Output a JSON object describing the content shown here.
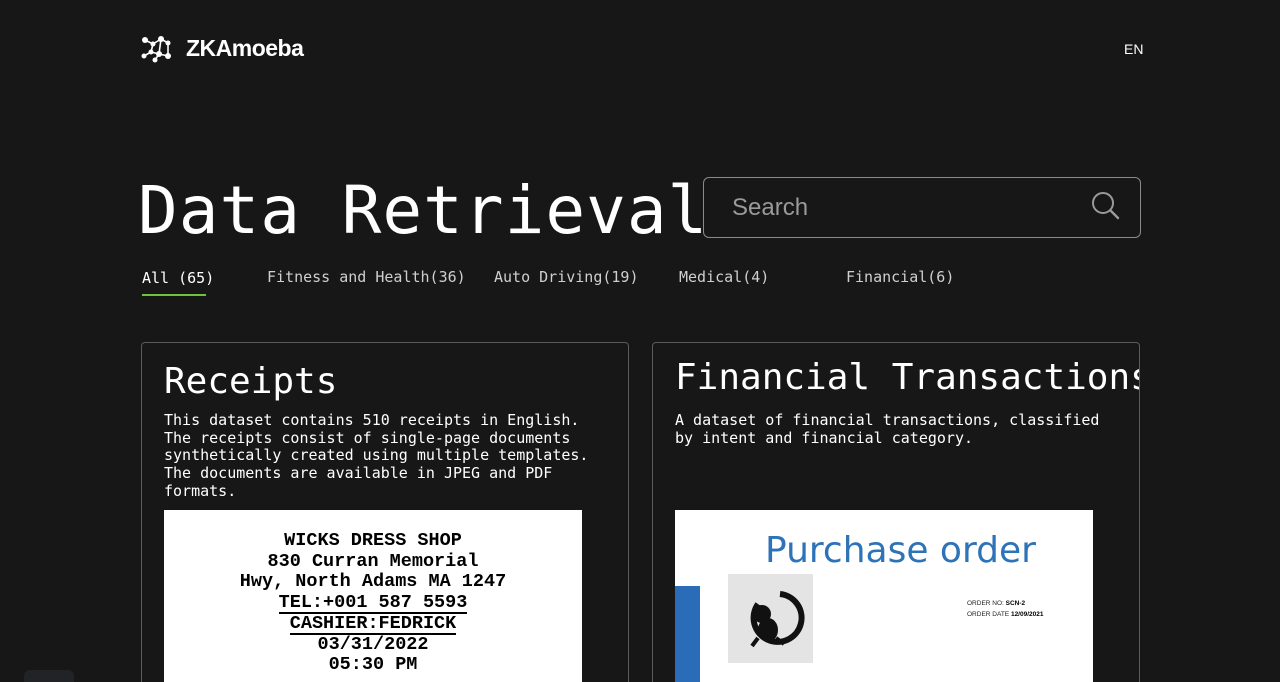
{
  "header": {
    "brand": "ZKAmoeba",
    "language": "EN"
  },
  "page": {
    "title": "Data Retrieval"
  },
  "search": {
    "placeholder": "Search",
    "value": ""
  },
  "tabs": [
    {
      "label": "All (65)",
      "active": true
    },
    {
      "label": "Fitness and Health(36)",
      "active": false
    },
    {
      "label": "Auto Driving(19)",
      "active": false
    },
    {
      "label": "Medical(4)",
      "active": false
    },
    {
      "label": "Financial(6)",
      "active": false
    }
  ],
  "accent_color": "#6fc23b",
  "cards": [
    {
      "title": "Receipts",
      "description": "This dataset contains 510 receipts in English. The receipts consist of single-page documents synthetically created using multiple templates. The documents are available in JPEG and PDF formats.",
      "preview": {
        "shop": "WICKS DRESS SHOP",
        "address1": "830 Curran Memorial",
        "address2": "Hwy, North Adams MA 1247",
        "tel": "TEL:+001 587 5593",
        "cashier": "CASHIER:FEDRICK",
        "date": "03/31/2022",
        "time": "05:30 PM"
      }
    },
    {
      "title": "Financial Transactions",
      "description": "A dataset of financial transactions, classified by intent and financial category.",
      "preview": {
        "heading": "Purchase order",
        "order_no_label": "ORDER NO:",
        "order_no": "SCN-2",
        "order_date_label": "ORDER DATE",
        "order_date": "12/09/2021"
      }
    }
  ]
}
